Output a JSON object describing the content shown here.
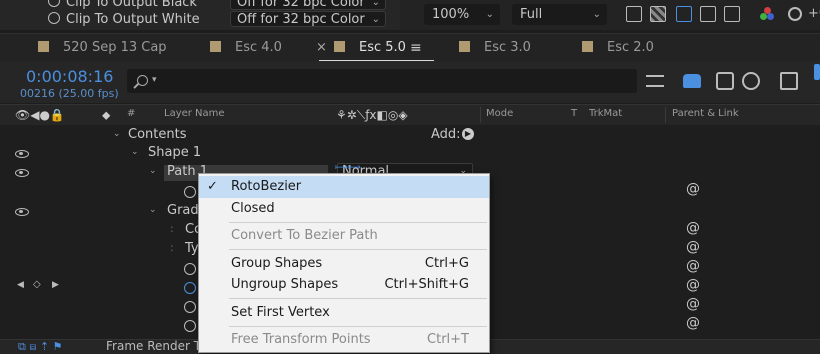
{
  "top": {
    "row1_label": "Clip To Output Black",
    "row1_value": "Off for 32 bpc Color",
    "row2_label": "Clip To Output White",
    "row2_value": "Off for 32 bpc Color",
    "zoom": "100%",
    "resolution": "Full"
  },
  "tabs": [
    {
      "label": "520 Sep 13 Cap"
    },
    {
      "label": "Esc 4.0"
    },
    {
      "label": "Esc 5.0"
    },
    {
      "label": "Esc 3.0"
    },
    {
      "label": "Esc 2.0"
    }
  ],
  "timecode": "0:00:08:16",
  "frame_info": "00216 (25.00 fps)",
  "colors": {
    "accent": "#4a8fe0",
    "menu_highlight": "#c5dcf5",
    "tab_swatch": "#b09a72"
  },
  "header": {
    "hash": "#",
    "layer_name": "Layer Name",
    "mode": "Mode",
    "t": "T",
    "trkmat": "TrkMat",
    "parent_link": "Parent & Link"
  },
  "layers": {
    "contents": "Contents",
    "add_label": "Add:",
    "shape1": "Shape 1",
    "shape1_mode": "Normal",
    "path1": "Path 1",
    "gradient_partial": "Gradi",
    "partial_c": "Co",
    "partial_ty": "Ty"
  },
  "context_menu": {
    "items": [
      {
        "label": "RotoBezier",
        "checked": true,
        "highlighted": true
      },
      {
        "label": "Closed"
      },
      {
        "label": "Convert To Bezier Path",
        "disabled": true
      },
      {
        "label": "Group Shapes",
        "shortcut": "Ctrl+G"
      },
      {
        "label": "Ungroup Shapes",
        "shortcut": "Ctrl+Shift+G"
      },
      {
        "label": "Set First Vertex"
      },
      {
        "label": "Free Transform Points",
        "shortcut": "Ctrl+T",
        "disabled": true
      }
    ]
  },
  "bottom": {
    "label": "Frame Render Ti"
  }
}
